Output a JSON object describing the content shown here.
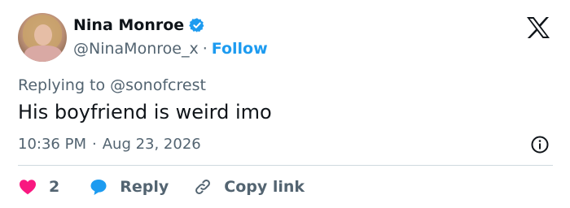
{
  "author": {
    "name": "Nina Monroe",
    "handle": "@NinaMonroe_x",
    "separator": "·",
    "follow_label": "Follow"
  },
  "tweet": {
    "replying_to": "Replying to @sonofcrest",
    "text": "His boyfriend is weird imo",
    "time": "10:36 PM",
    "date_separator": "·",
    "date": "Aug 23, 2026"
  },
  "actions": {
    "like_count": "2",
    "reply_label": "Reply",
    "copy_link_label": "Copy link"
  },
  "icons": {
    "verified": "verified-badge-icon",
    "logo": "x-logo-icon",
    "info": "info-icon",
    "like": "heart-icon",
    "reply": "speech-bubble-icon",
    "copy": "link-icon"
  },
  "colors": {
    "accent": "#1d9bf0",
    "like": "#f91880",
    "muted_text": "#536471",
    "text": "#0f1419",
    "divider": "#cfd9de"
  }
}
